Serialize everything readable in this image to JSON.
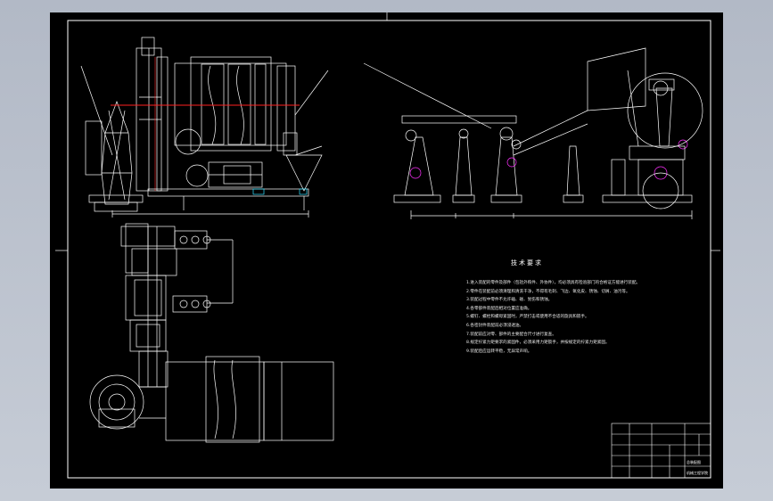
{
  "notes": {
    "title": "技术要求",
    "items": [
      "1.进入装配的零件及部件（包括外购件、外协件），均必须具有检验部门的合格证方能进行装配。",
      "2.零件在装配前必须清理和清洗干净，不得有毛刺、飞边、氧化皮、锈蚀、切屑、油污等。",
      "3.装配过程中零件不允许磕、碰、划伤和锈蚀。",
      "4.各零部件装配后相对位置应准确。",
      "5.螺钉、螺栓和螺母紧固时，严禁打击或使用不合适的旋具和扳手。",
      "6.各密封件装配前必须浸透油。",
      "7.装配前应对零、部件的主要配合尺寸进行复查。",
      "8.规定拧紧力矩要求的紧固件，必须采用力矩扳手，并按规定的拧紧力矩紧固。",
      "9.装配后应运转平稳，无异常声响。"
    ]
  },
  "title_block": {
    "drawing_name": "总装配图",
    "school": "机械工程学院"
  },
  "colors": {
    "line": "#ffffff",
    "red_line": "#ff2020",
    "magenta": "#ff30ff",
    "cyan": "#30e0ff",
    "sheet": "#000000"
  }
}
